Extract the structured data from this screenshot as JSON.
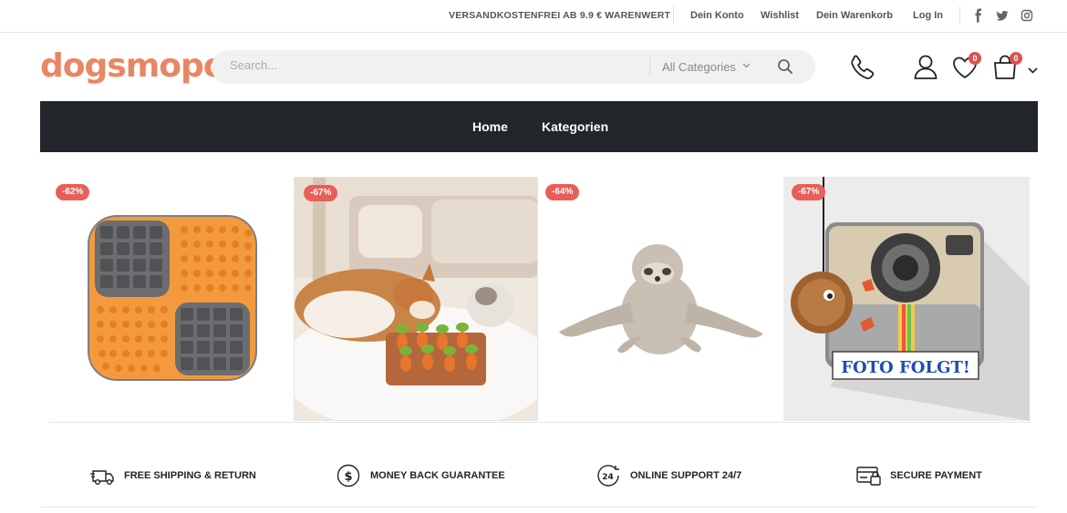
{
  "topbar": {
    "shipping_text": "VERSANDKOSTENFREI AB 9.9 € WARENWERT",
    "links": [
      "Dein Konto",
      "Wishlist",
      "Dein Warenkorb",
      "Log In"
    ],
    "social_icons": [
      "facebook-icon",
      "twitter-icon",
      "instagram-icon"
    ]
  },
  "header": {
    "logo": "dogsmopoli",
    "search": {
      "placeholder": "Search...",
      "category": "All Categories"
    },
    "wishlist_count": "0",
    "cart_count": "0"
  },
  "nav": {
    "items": [
      "Home",
      "Kategorien"
    ]
  },
  "products": [
    {
      "discount": "-62%"
    },
    {
      "discount": "-67%"
    },
    {
      "discount": "-64%"
    },
    {
      "discount": "-67%",
      "image_text": "FOTO FOLGT!"
    }
  ],
  "features": [
    {
      "label": "FREE SHIPPING & RETURN",
      "icon": "truck-icon"
    },
    {
      "label": "MONEY BACK GUARANTEE",
      "icon": "dollar-icon"
    },
    {
      "label": "ONLINE SUPPORT 24/7",
      "icon": "support-24-icon"
    },
    {
      "label": "SECURE PAYMENT",
      "icon": "secure-payment-icon"
    }
  ],
  "colors": {
    "brand": "#e98663",
    "nav_bg": "#222529",
    "badge": "#e85f5a"
  }
}
